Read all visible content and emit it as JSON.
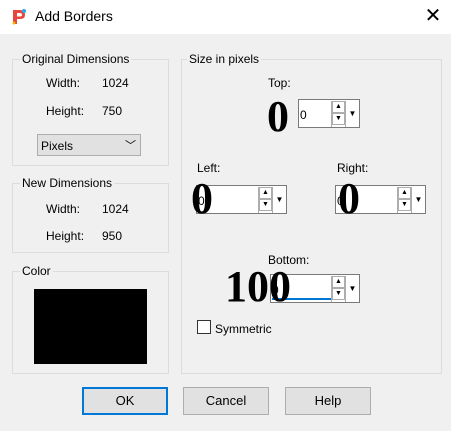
{
  "window": {
    "title": "Add Borders",
    "close_glyph": "✕"
  },
  "original_dimensions": {
    "legend": "Original Dimensions",
    "width_label": "Width:",
    "width_value": "1024",
    "height_label": "Height:",
    "height_value": "750",
    "unit": "Pixels"
  },
  "new_dimensions": {
    "legend": "New Dimensions",
    "width_label": "Width:",
    "width_value": "1024",
    "height_label": "Height:",
    "height_value": "950"
  },
  "color": {
    "legend": "Color",
    "value": "#000000"
  },
  "size_in_pixels": {
    "legend": "Size in pixels",
    "top_label": "Top:",
    "top_value": "0",
    "top_big": "0",
    "left_label": "Left:",
    "left_value": "0",
    "left_big": "0",
    "right_label": "Right:",
    "right_value": "0",
    "right_big": "0",
    "bottom_label": "Bottom:",
    "bottom_value": "0",
    "bottom_big": "100",
    "symmetric_label": "Symmetric",
    "symmetric_checked": false
  },
  "buttons": {
    "ok": "OK",
    "cancel": "Cancel",
    "help": "Help"
  }
}
